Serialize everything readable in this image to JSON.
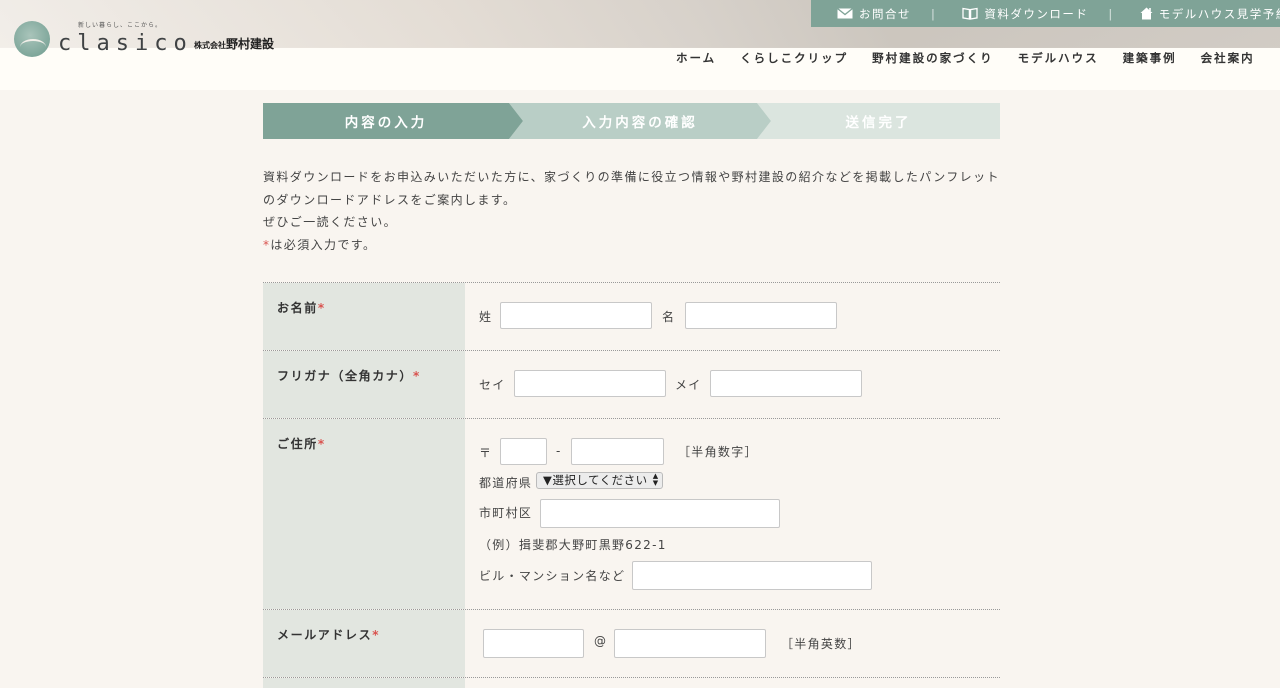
{
  "header": {
    "tagline": "新しい暮らし、ここから。",
    "logo_text": "clasico",
    "company_small": "株式会社",
    "company_name": "野村建設",
    "top_links": [
      {
        "label": "お問合せ",
        "icon": "mail-icon"
      },
      {
        "label": "資料ダウンロード",
        "icon": "book-icon"
      },
      {
        "label": "モデルハウス見学予約",
        "icon": "house-icon"
      }
    ],
    "separator": "|",
    "nav": [
      "ホーム",
      "くらしこクリップ",
      "野村建設の家づくり",
      "モデルハウス",
      "建築事例",
      "会社案内"
    ]
  },
  "steps": [
    "内容の入力",
    "入力内容の確認",
    "送信完了"
  ],
  "intro": {
    "line1": "資料ダウンロードをお申込みいただいた方に、家づくりの準備に役立つ情報や野村建設の紹介などを掲載したパンフレット",
    "line2": "のダウンロードアドレスをご案内します。",
    "line3": "ぜひご一読ください。",
    "req_mark": "*",
    "req_text": "は必須入力です。"
  },
  "form": {
    "name": {
      "label": "お名前",
      "sei_label": "姓",
      "mei_label": "名"
    },
    "kana": {
      "label": "フリガナ（全角カナ）",
      "sei_label": "セイ",
      "mei_label": "メイ"
    },
    "address": {
      "label": "ご住所",
      "zip_prefix": "〒",
      "zip_dash": "-",
      "zip_note": "［半角数字］",
      "pref_label": "都道府県",
      "pref_selected": "▼選択してください",
      "city_label": "市町村区",
      "example": "（例）揖斐郡大野町黒野622-1",
      "building_label": "ビル・マンション名など"
    },
    "email": {
      "label": "メールアドレス",
      "at": "@",
      "note": "［半角英数］"
    },
    "required_mark": "*"
  },
  "colors": {
    "accent": "#7fa397",
    "required": "#d9534f",
    "label_bg": "#e2e6e0",
    "page_bg": "#f9f5f0"
  }
}
